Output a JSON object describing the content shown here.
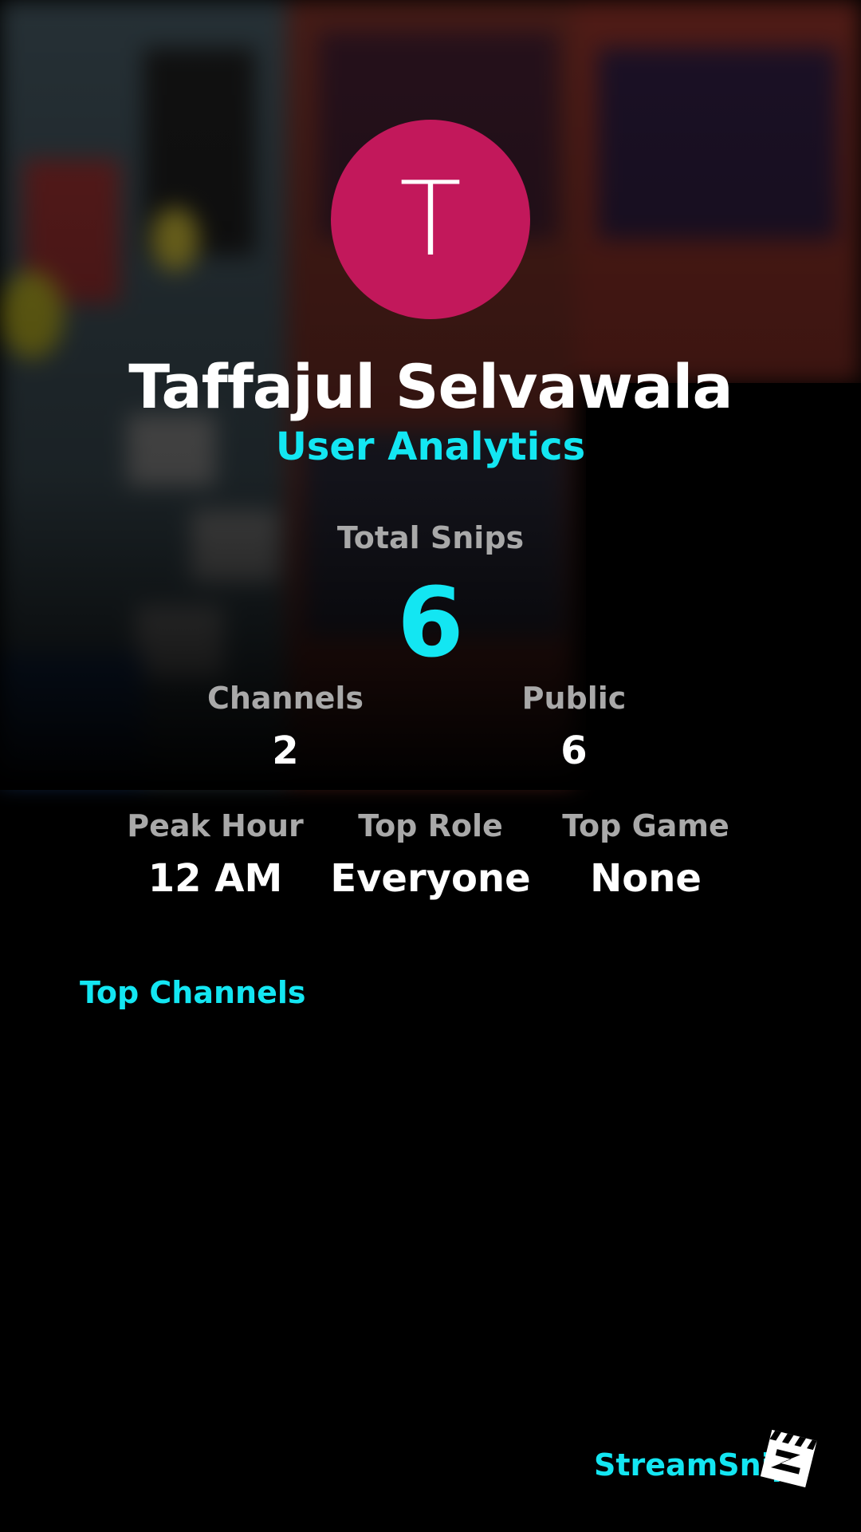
{
  "profile": {
    "avatar_initial": "T",
    "avatar_color": "#c2185b",
    "name": "Taffajul Selvawala",
    "subtitle": "User Analytics"
  },
  "stats": {
    "total_snips": {
      "label": "Total Snips",
      "value": "6"
    },
    "channels": {
      "label": "Channels",
      "value": "2"
    },
    "public": {
      "label": "Public",
      "value": "6"
    },
    "peak_hour": {
      "label": "Peak Hour",
      "value": "12 AM"
    },
    "top_role": {
      "label": "Top Role",
      "value": "Everyone"
    },
    "top_game": {
      "label": "Top Game",
      "value": "None"
    }
  },
  "sections": {
    "top_channels": "Top Channels"
  },
  "footer": {
    "brand": "StreamSnip",
    "logo_icon": "clapperboard-icon"
  },
  "colors": {
    "accent": "#13e6f2",
    "label": "#a9a9a9",
    "background": "#000000"
  }
}
